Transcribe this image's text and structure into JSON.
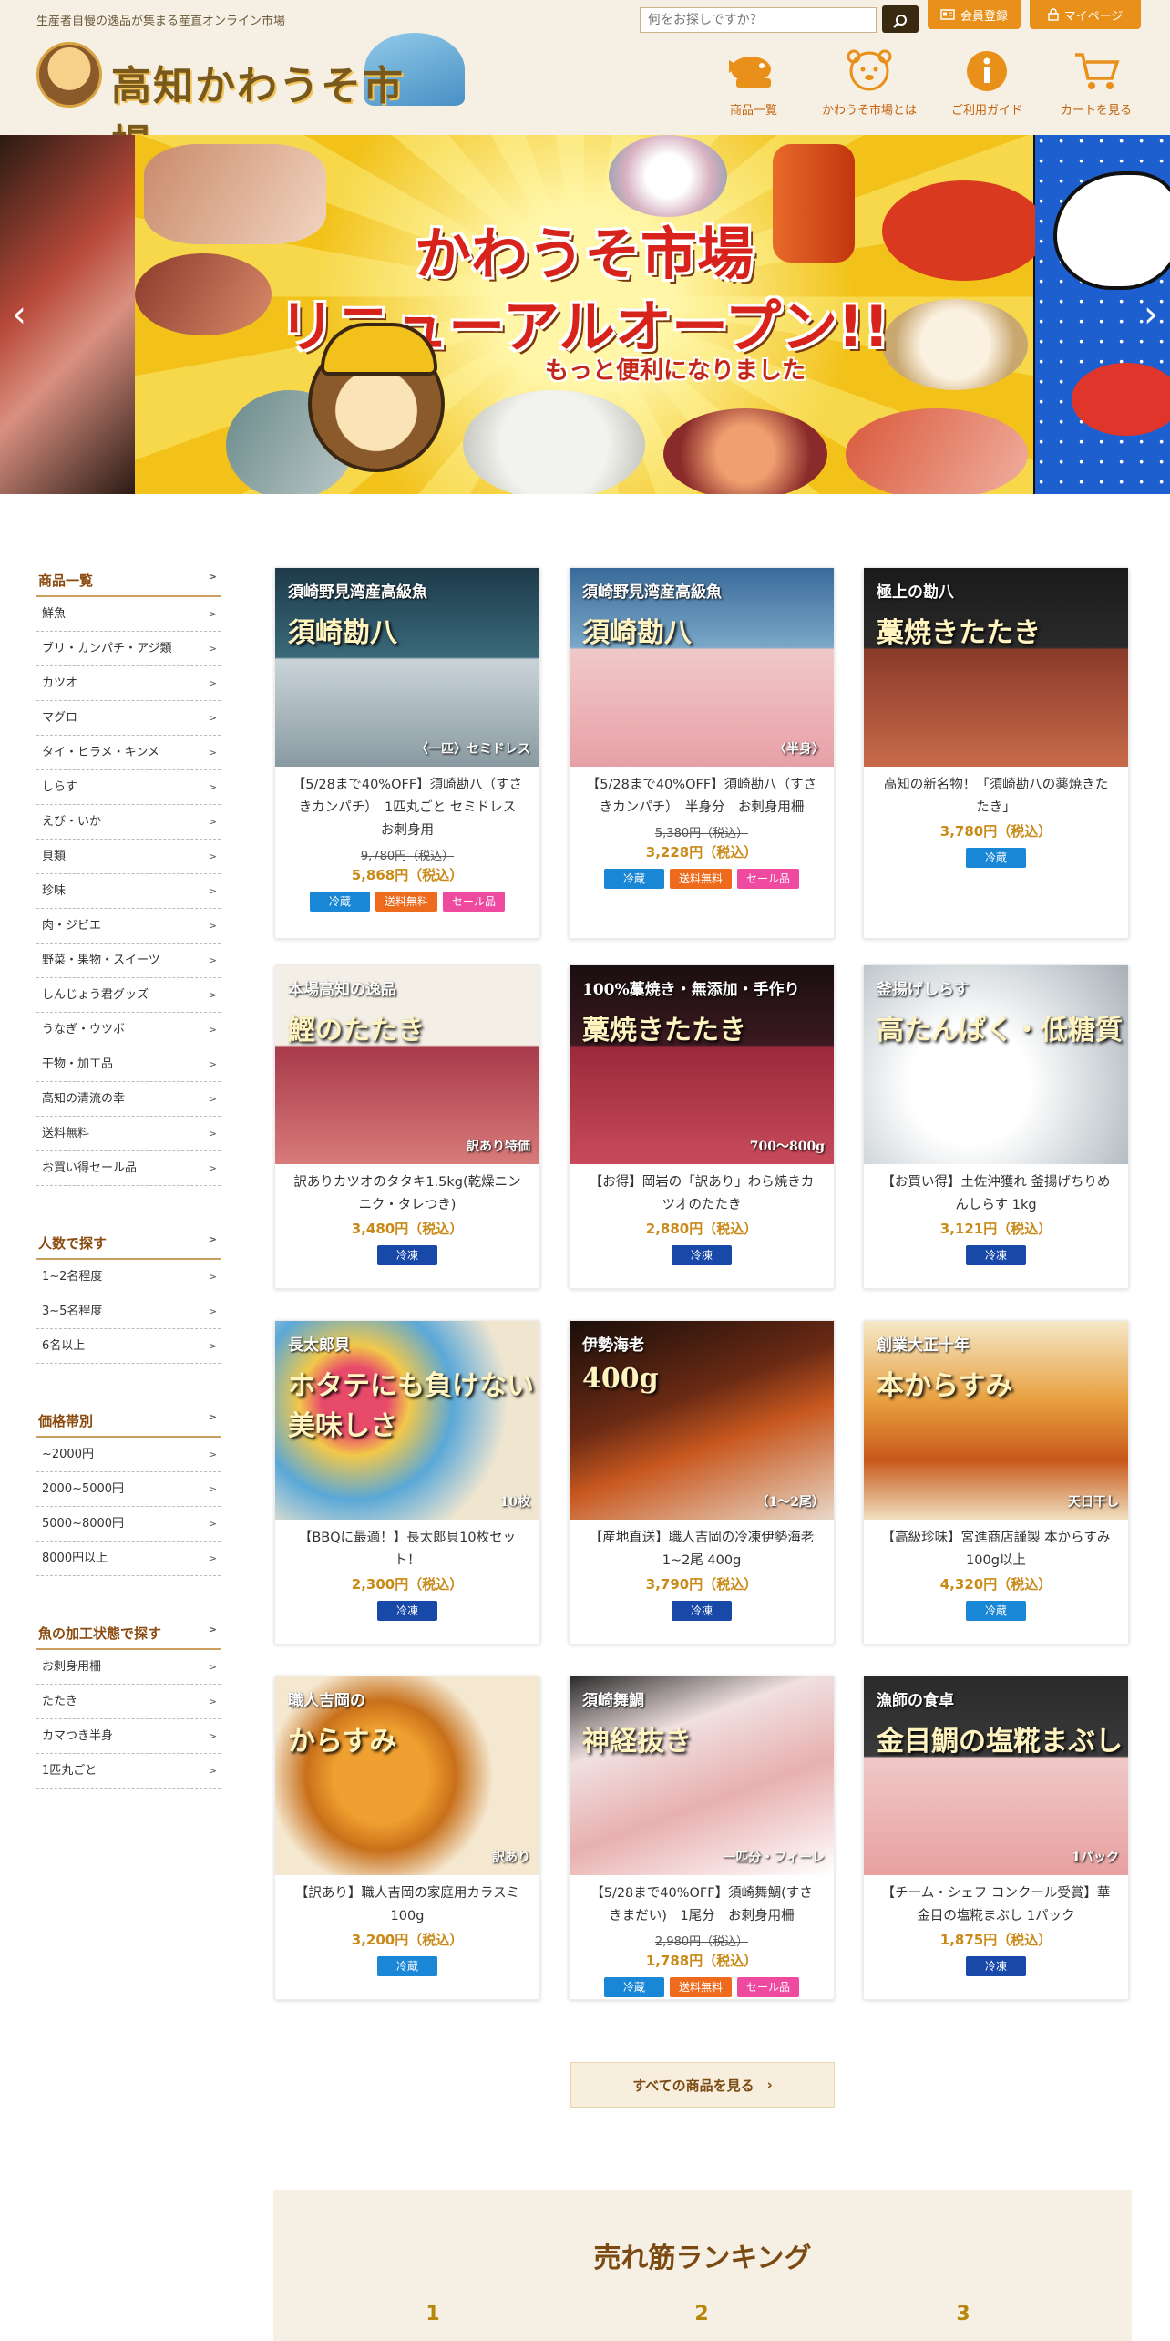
{
  "header": {
    "tagline": "生産者自慢の逸品が集まる産直オンライン市場",
    "logo_text": "高知かわうそ市場",
    "search_placeholder": "何をお探しですか？",
    "member_label": "会員登録",
    "mypage_label": "マイページ",
    "nav": [
      {
        "label": "商品一覧",
        "icon": "fish-basket-icon"
      },
      {
        "label": "かわうそ市場とは",
        "icon": "otter-face-icon"
      },
      {
        "label": "ご利用ガイド",
        "icon": "info-icon"
      },
      {
        "label": "カートを見る",
        "icon": "cart-icon"
      }
    ]
  },
  "hero": {
    "title_line1": "かわうそ市場",
    "title_line2": "リニューアルオープン!!",
    "subtitle": "もっと便利になりました"
  },
  "sidebar": {
    "groups": [
      {
        "heading": "商品一覧",
        "items": [
          "鮮魚",
          "ブリ・カンパチ・アジ類",
          "カツオ",
          "マグロ",
          "タイ・ヒラメ・キンメ",
          "しらす",
          "えび・いか",
          "貝類",
          "珍味",
          "肉・ジビエ",
          "野菜・果物・スイーツ",
          "しんじょう君グッズ",
          "うなぎ・ウツボ",
          "干物・加工品",
          "高知の清流の幸",
          "送料無料",
          "お買い得セール品"
        ]
      },
      {
        "heading": "人数で探す",
        "items": [
          "1~2名程度",
          "3~5名程度",
          "6名以上"
        ]
      },
      {
        "heading": "価格帯別",
        "items": [
          "~2000円",
          "2000~5000円",
          "5000~8000円",
          "8000円以上"
        ]
      },
      {
        "heading": "魚の加工状態で探す",
        "items": [
          "お刺身用柵",
          "たたき",
          "カマつき半身",
          "1匹丸ごと"
        ]
      }
    ]
  },
  "products": [
    {
      "title": "【5/28まで40%OFF】須崎勘八（すさきカンパチ）　1匹丸ごと セミドレス　お刺身用",
      "old_price": "9,780円（税込）",
      "price": "5,868円（税込）",
      "badges": [
        "冷蔵",
        "送料無料",
        "セール品"
      ],
      "img_text1": "須崎野見湾産高級魚",
      "img_text2": "須崎勘八",
      "img_text3": "〈一匹〉セミドレス"
    },
    {
      "title": "【5/28まで40%OFF】須崎勘八（すさきカンパチ）　半身分　お刺身用柵",
      "old_price": "5,380円（税込）",
      "price": "3,228円（税込）",
      "badges": [
        "冷蔵",
        "送料無料",
        "セール品"
      ],
      "img_text1": "須崎野見湾産高級魚",
      "img_text2": "須崎勘八",
      "img_text3": "〈半身〉"
    },
    {
      "title": "高知の新名物！「須崎勘八の薬焼きたたき」",
      "old_price": "",
      "price": "3,780円（税込）",
      "badges": [
        "冷蔵"
      ],
      "img_text1": "極上の勘八",
      "img_text2": "藁焼きたたき",
      "img_text3": ""
    },
    {
      "title": "訳ありカツオのタタキ1.5kg(乾燥ニンニク・タレつき)",
      "old_price": "",
      "price": "3,480円（税込）",
      "badges": [
        "冷凍"
      ],
      "img_text1": "本場高知の逸品",
      "img_text2": "鰹のたたき",
      "img_text3": "訳あり特価"
    },
    {
      "title": "【お得】岡岩の「訳あり」わら焼きカツオのたたき",
      "old_price": "",
      "price": "2,880円（税込）",
      "badges": [
        "冷凍"
      ],
      "img_text1": "100%藁焼き・無添加・手作り",
      "img_text2": "藁焼きたたき",
      "img_text3": "700～800g"
    },
    {
      "title": "【お買い得】土佐沖獲れ 釜揚げちりめんしらす 1kg",
      "old_price": "",
      "price": "3,121円（税込）",
      "badges": [
        "冷凍"
      ],
      "img_text1": "釜揚げしらす",
      "img_text2": "高たんぱく・低糖質",
      "img_text3": ""
    },
    {
      "title": "【BBQに最適！】長太郎貝10枚セット！",
      "old_price": "",
      "price": "2,300円（税込）",
      "badges": [
        "冷凍"
      ],
      "img_text1": "長太郎貝",
      "img_text2": "ホタテにも負けない美味しさ",
      "img_text3": "10枚"
    },
    {
      "title": "【産地直送】職人吉岡の冷凍伊勢海老 1~2尾 400g",
      "old_price": "",
      "price": "3,790円（税込）",
      "badges": [
        "冷凍"
      ],
      "img_text1": "伊勢海老",
      "img_text2": "400g",
      "img_text3": "（1～2尾）"
    },
    {
      "title": "【高級珍味】宮進商店謹製 本からすみ 100g以上",
      "old_price": "",
      "price": "4,320円（税込）",
      "badges": [
        "冷蔵"
      ],
      "img_text1": "創業大正十年",
      "img_text2": "本からすみ",
      "img_text3": "天日干し"
    },
    {
      "title": "【訳あり】職人吉岡の家庭用カラスミ100g",
      "old_price": "",
      "price": "3,200円（税込）",
      "badges": [
        "冷蔵"
      ],
      "img_text1": "職人吉岡の",
      "img_text2": "からすみ",
      "img_text3": "訳あり"
    },
    {
      "title": "【5/28まで40%OFF】須崎舞鯛(すさきまだい)　1尾分　お刺身用柵",
      "old_price": "2,980円（税込）",
      "price": "1,788円（税込）",
      "badges": [
        "冷蔵",
        "送料無料",
        "セール品"
      ],
      "img_text1": "須崎舞鯛",
      "img_text2": "神経抜き",
      "img_text3": "一匹分・フィーレ"
    },
    {
      "title": "【チーム・シェフ コンクール受賞】華金目の塩糀まぶし 1パック",
      "old_price": "",
      "price": "1,875円（税込）",
      "badges": [
        "冷凍"
      ],
      "img_text1": "漁師の食卓",
      "img_text2": "金目鯛の塩糀まぶし",
      "img_text3": "1パック"
    }
  ],
  "all_products_label": "すべての商品を見る",
  "ranking": {
    "title": "売れ筋ランキング",
    "ranks": [
      "1",
      "2",
      "3"
    ]
  },
  "colors": {
    "accent": "#e8901a",
    "header_bg": "#f6efe3",
    "price": "#c98a18",
    "cold": "#1a86d6",
    "frozen": "#1848a8",
    "free": "#ee6a1c",
    "sale": "#ee4aa0"
  }
}
